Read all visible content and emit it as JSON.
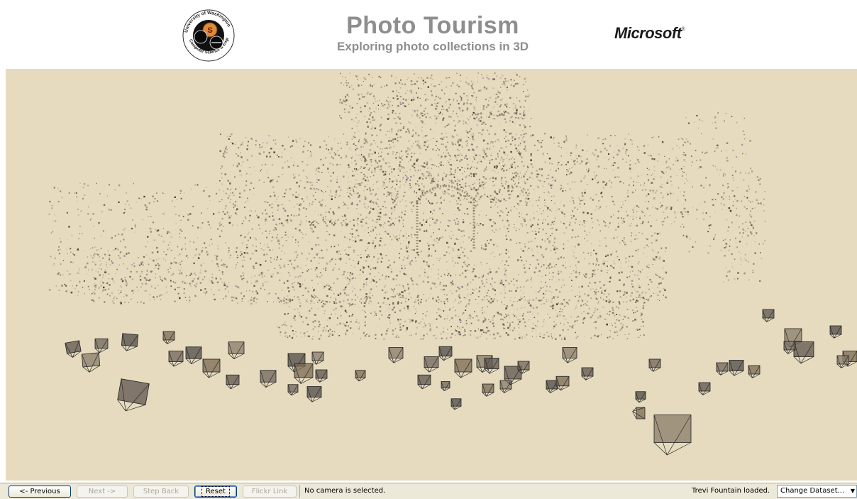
{
  "header": {
    "title": "Photo Tourism",
    "subtitle": "Exploring photo collections in 3D",
    "uw_logo": {
      "icon": "university-seal-icon",
      "ring_text": "University of Washington · Computer Science & Engineering",
      "letters": [
        "S",
        "C",
        "E"
      ]
    },
    "microsoft_logo": {
      "text": "Microsoft",
      "mark": "®"
    }
  },
  "viewport": {
    "background": "#e6dbbe",
    "content": "3D point cloud reconstruction with camera frusta"
  },
  "toolbar": {
    "previous_label": "<- Previous",
    "next_label": "Next ->",
    "step_back_label": "Step Back",
    "reset_label": "Reset",
    "flickr_link_label": "Flickr Link",
    "status": "No camera is selected.",
    "loaded": "Trevi Fountain loaded.",
    "dataset_select": {
      "selected": "Change Dataset...",
      "icon": "chevron-down-icon"
    }
  },
  "colors": {
    "title": "#8e8e8e",
    "viewport_bg": "#e6dbbe",
    "toolbar_bg": "#ece9d8",
    "button_border": "#003c74"
  }
}
